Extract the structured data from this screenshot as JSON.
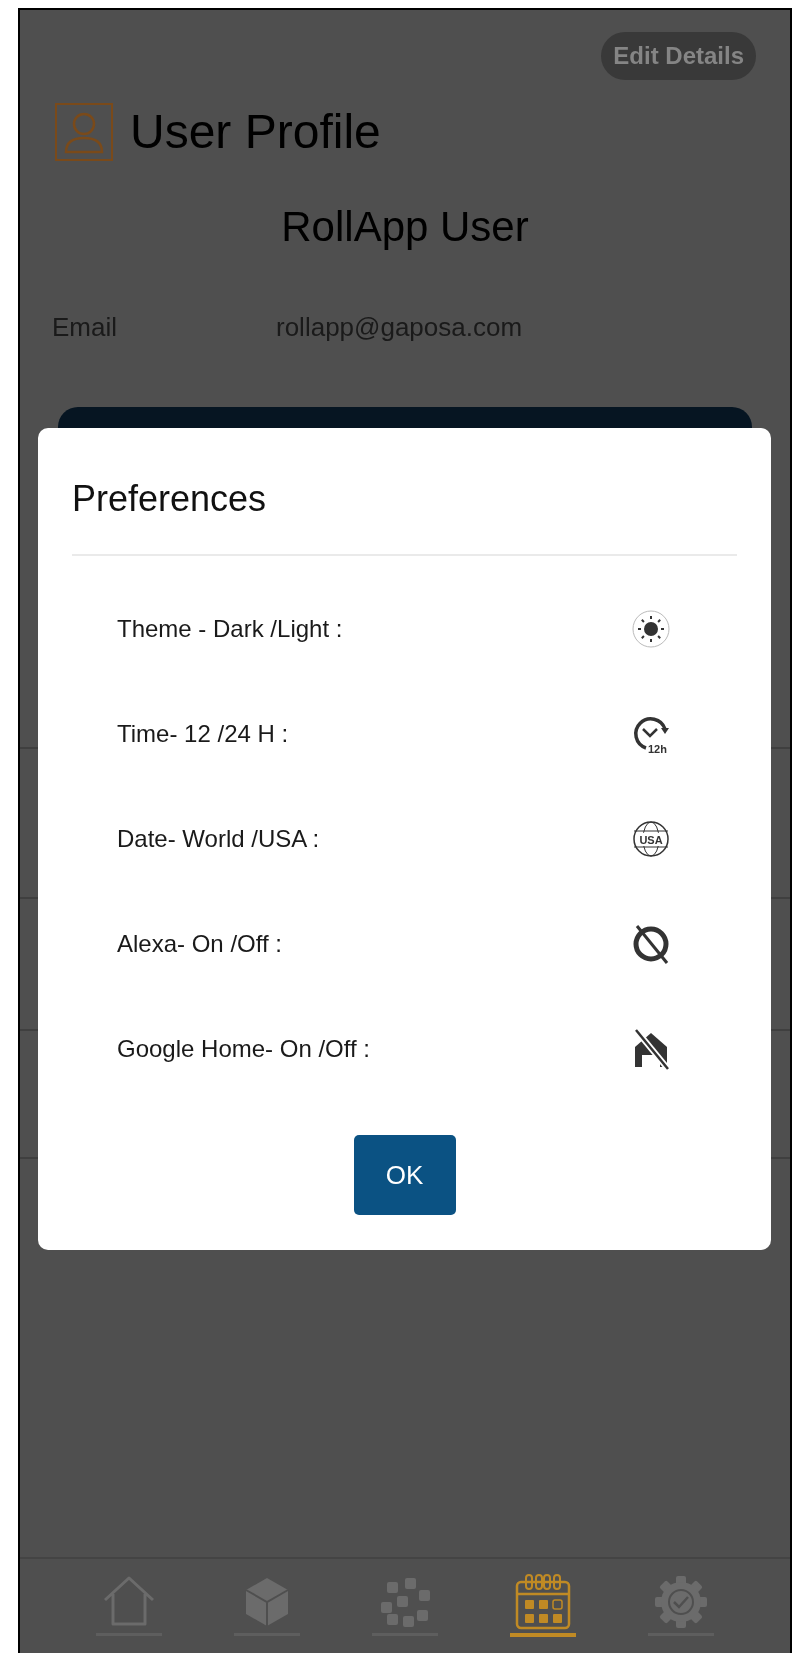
{
  "header": {
    "edit_button": "Edit Details",
    "title": "User Profile",
    "user_name": "RollApp User",
    "email_label": "Email",
    "email_value": "rollapp@gaposa.com"
  },
  "dialog": {
    "title": "Preferences",
    "items": [
      {
        "label": "Theme - Dark /Light :",
        "kind": "theme"
      },
      {
        "label": "Time- 12 /24 H :",
        "kind": "time",
        "icon_text": "12h"
      },
      {
        "label": "Date- World /USA :",
        "kind": "date",
        "icon_text": "USA"
      },
      {
        "label": "Alexa- On /Off :",
        "kind": "alexa"
      },
      {
        "label": "Google Home- On /Off :",
        "kind": "google"
      }
    ],
    "ok_button": "OK"
  },
  "nav": [
    {
      "kind": "home",
      "selected": false
    },
    {
      "kind": "rooms",
      "selected": false
    },
    {
      "kind": "groups",
      "selected": false
    },
    {
      "kind": "schedule",
      "selected": true
    },
    {
      "kind": "settings",
      "selected": false
    }
  ]
}
